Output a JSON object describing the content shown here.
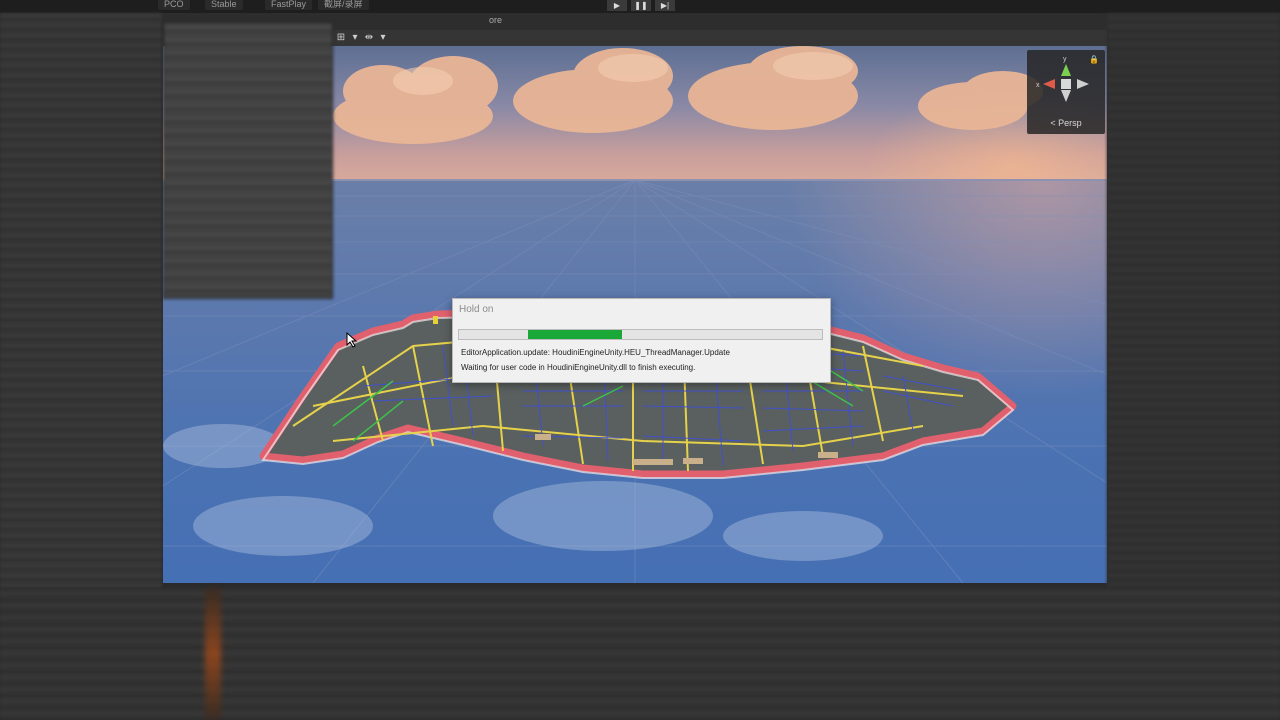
{
  "toolbar": {
    "items": [
      "PCO",
      "Stable",
      "FastPlay",
      "截屏/录屏"
    ],
    "play_icon": "play-icon",
    "pause_icon": "pause-icon",
    "step_icon": "step-icon"
  },
  "scene": {
    "header_label": "ore",
    "gizmo": {
      "x_label": "x",
      "y_label": "y",
      "projection_label": "< Persp"
    }
  },
  "dialog": {
    "title": "Hold on",
    "progress": 0.26,
    "progress_color": "#1aa838",
    "line1": "EditorApplication.update: HoudiniEngineUnity.HEU_ThreadManager.Update",
    "line2": "Waiting for user code in HoudiniEngineUnity.dll to finish executing."
  },
  "colors": {
    "road_major": "#e6d24a",
    "road_minor": "#3f4fd6",
    "road_green": "#3ec24a",
    "coast": "#e0606e",
    "progress": "#1aa838"
  }
}
